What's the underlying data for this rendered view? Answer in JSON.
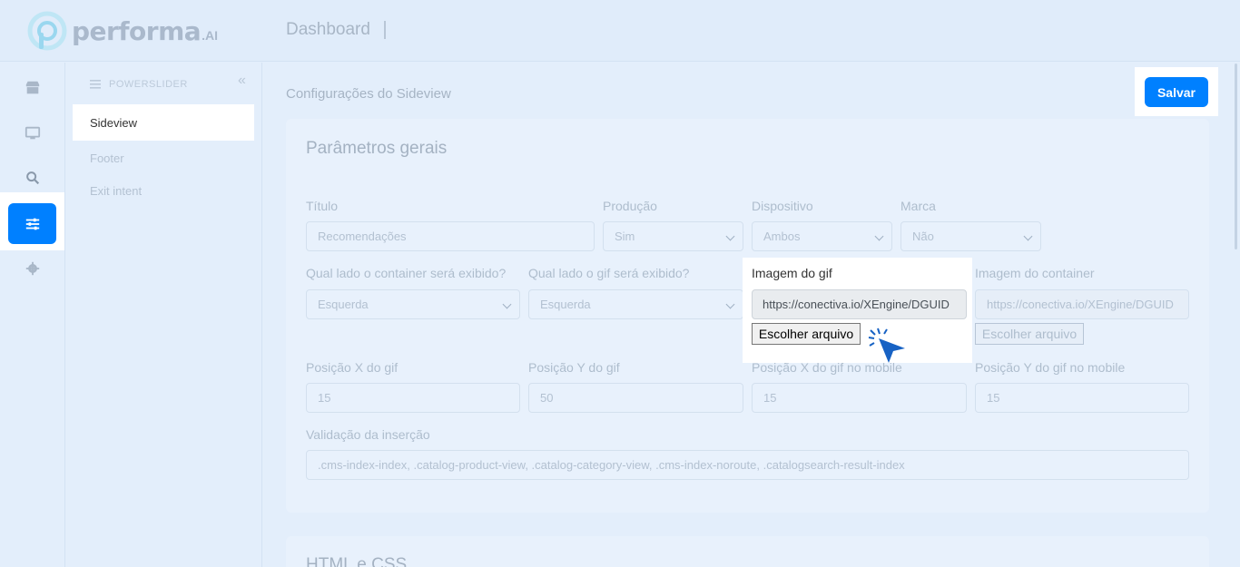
{
  "brand": {
    "name": "performa",
    "suffix": ".AI"
  },
  "header": {
    "title": "Dashboard"
  },
  "rail": {
    "items": [
      "store-icon",
      "monitor-icon",
      "search-icon",
      "sliders-icon",
      "gear-icon"
    ],
    "active": "sliders-icon"
  },
  "subnav": {
    "heading": "POWERSLIDER",
    "items": [
      {
        "label": "Sideview",
        "active": true
      },
      {
        "label": "Footer",
        "active": false
      },
      {
        "label": "Exit intent",
        "active": false
      }
    ]
  },
  "page": {
    "title": "Configurações do Sideview",
    "save_label": "Salvar"
  },
  "form": {
    "section_title": "Parâmetros gerais",
    "titulo": {
      "label": "Título",
      "value": "Recomendações"
    },
    "producao": {
      "label": "Produção",
      "value": "Sim"
    },
    "dispositivo": {
      "label": "Dispositivo",
      "value": "Ambos"
    },
    "marca": {
      "label": "Marca",
      "value": "Não"
    },
    "lado_container": {
      "label": "Qual lado o container será exibido?",
      "value": "Esquerda"
    },
    "lado_gif": {
      "label": "Qual lado o gif será exibido?",
      "value": "Esquerda"
    },
    "imagem_gif": {
      "label": "Imagem do gif",
      "value": "https://conectiva.io/XEngine/DGUID",
      "button": "Escolher arquivo"
    },
    "imagem_container": {
      "label": "Imagem do container",
      "value": "https://conectiva.io/XEngine/DGUID",
      "button": "Escolher arquivo"
    },
    "pos_x_gif": {
      "label": "Posição X do gif",
      "value": "15"
    },
    "pos_y_gif": {
      "label": "Posição Y do gif",
      "value": "50"
    },
    "pos_x_mobile": {
      "label": "Posição X do gif no mobile",
      "value": "15"
    },
    "pos_y_mobile": {
      "label": "Posição Y do gif no mobile",
      "value": "15"
    },
    "validacao": {
      "label": "Validação da inserção",
      "value": ".cms-index-index, .catalog-product-view, .catalog-category-view, .cms-index-noroute, .catalogsearch-result-index"
    }
  },
  "section2": {
    "title": "HTML e CSS"
  },
  "colors": {
    "accent": "#0080ff",
    "background": "#e3eefb"
  }
}
